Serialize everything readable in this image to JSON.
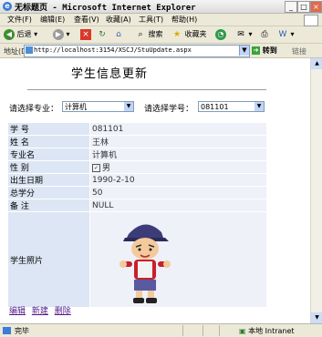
{
  "window": {
    "title": "无标题页 - Microsoft Internet Explorer"
  },
  "menu": [
    "文件(F)",
    "编辑(E)",
    "查看(V)",
    "收藏(A)",
    "工具(T)",
    "帮助(H)"
  ],
  "toolbar": {
    "back": "后退",
    "search": "搜索",
    "favorites": "收藏夹"
  },
  "address": {
    "label": "地址(D)",
    "url": "http://localhost:3154/XSCJ/StuUpdate.aspx",
    "go": "转到",
    "links": "链接"
  },
  "page": {
    "title": "学生信息更新",
    "major_label": "请选择专业：",
    "major_value": "计算机",
    "sno_label": "请选择学号：",
    "sno_value": "081101"
  },
  "student": {
    "rows": [
      {
        "key": "学 号",
        "value": "081101"
      },
      {
        "key": "姓 名",
        "value": "王林"
      },
      {
        "key": "专业名",
        "value": "计算机"
      },
      {
        "key": "性 别",
        "value": "男",
        "checked": true
      },
      {
        "key": "出生日期",
        "value": "1990-2-10"
      },
      {
        "key": "总学分",
        "value": "50"
      },
      {
        "key": "备 注",
        "value": "NULL"
      }
    ],
    "photo_label": "学生照片"
  },
  "actions": {
    "edit": "编辑",
    "new": "新建",
    "delete": "删除"
  },
  "status": {
    "text": "完毕",
    "zone": "本地 Intranet"
  }
}
